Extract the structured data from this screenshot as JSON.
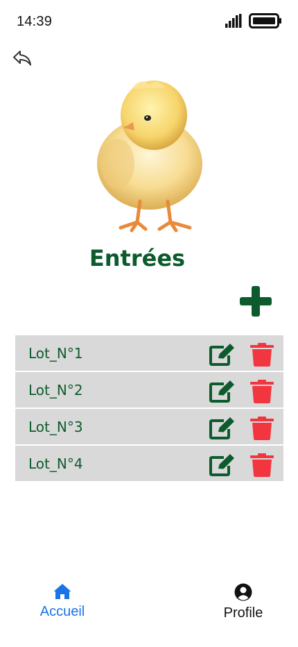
{
  "status_bar": {
    "time": "14:39"
  },
  "header": {
    "title": "Entrées"
  },
  "actions": {
    "add_icon": "plus-icon",
    "back_icon": "back-arrow-icon"
  },
  "lots": [
    {
      "label": "Lot_N°1"
    },
    {
      "label": "Lot_N°2"
    },
    {
      "label": "Lot_N°3"
    },
    {
      "label": "Lot_N°4"
    }
  ],
  "row_icons": {
    "edit": "edit-icon",
    "delete": "trash-icon"
  },
  "bottom_nav": {
    "items": [
      {
        "label": "Accueil",
        "icon": "home-icon",
        "active": true
      },
      {
        "label": "Profile",
        "icon": "user-circle-icon",
        "active": false
      }
    ]
  },
  "colors": {
    "primary_green": "#0d5b2d",
    "delete_red": "#f2363f",
    "row_background": "#d9d9d9",
    "nav_active": "#1a73e8"
  }
}
